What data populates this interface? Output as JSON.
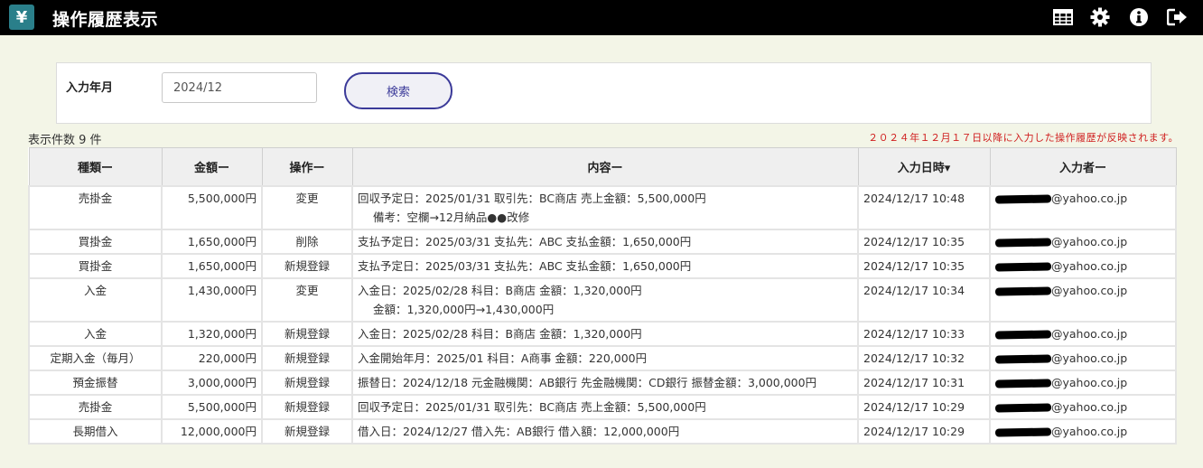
{
  "header": {
    "logo": "¥",
    "title": "操作履歴表示",
    "icons": [
      "table-icon",
      "gear-icon",
      "info-icon",
      "logout-icon"
    ]
  },
  "search": {
    "label": "入力年月",
    "value": "2024/12",
    "button": "検索"
  },
  "count_label": "表示件数 9 件",
  "notice": "２０２４年１２月１７日以降に入力した操作履歴が反映されます。",
  "table": {
    "headers": [
      "種類ー",
      "金額ー",
      "操作ー",
      "内容ー",
      "入力日時▾",
      "入力者ー"
    ],
    "rows": [
      {
        "type": "売掛金",
        "amount": "5,500,000円",
        "op": "変更",
        "content": "回収予定日：2025/01/31 取引先：BC商店 売上金額：5,500,000円",
        "content2": "備考：空欄→12月納品●●改修",
        "date": "2024/12/17 10:48",
        "user": "@yahoo.co.jp"
      },
      {
        "type": "買掛金",
        "amount": "1,650,000円",
        "op": "削除",
        "content": "支払予定日：2025/03/31 支払先：ABC 支払金額：1,650,000円",
        "content2": "",
        "date": "2024/12/17 10:35",
        "user": "@yahoo.co.jp"
      },
      {
        "type": "買掛金",
        "amount": "1,650,000円",
        "op": "新規登録",
        "content": "支払予定日：2025/03/31 支払先：ABC 支払金額：1,650,000円",
        "content2": "",
        "date": "2024/12/17 10:35",
        "user": "@yahoo.co.jp"
      },
      {
        "type": "入金",
        "amount": "1,430,000円",
        "op": "変更",
        "content": "入金日：2025/02/28 科目：B商店 金額：1,320,000円",
        "content2": "金額：1,320,000円→1,430,000円",
        "date": "2024/12/17 10:34",
        "user": "@yahoo.co.jp"
      },
      {
        "type": "入金",
        "amount": "1,320,000円",
        "op": "新規登録",
        "content": "入金日：2025/02/28 科目：B商店 金額：1,320,000円",
        "content2": "",
        "date": "2024/12/17 10:33",
        "user": "@yahoo.co.jp"
      },
      {
        "type": "定期入金（毎月）",
        "amount": "220,000円",
        "op": "新規登録",
        "content": "入金開始年月：2025/01 科目：A商事 金額：220,000円",
        "content2": "",
        "date": "2024/12/17 10:32",
        "user": "@yahoo.co.jp"
      },
      {
        "type": "預金振替",
        "amount": "3,000,000円",
        "op": "新規登録",
        "content": "振替日：2024/12/18 元金融機関：AB銀行 先金融機関：CD銀行 振替金額：3,000,000円",
        "content2": "",
        "date": "2024/12/17 10:31",
        "user": "@yahoo.co.jp"
      },
      {
        "type": "売掛金",
        "amount": "5,500,000円",
        "op": "新規登録",
        "content": "回収予定日：2025/01/31 取引先：BC商店 売上金額：5,500,000円",
        "content2": "",
        "date": "2024/12/17 10:29",
        "user": "@yahoo.co.jp"
      },
      {
        "type": "長期借入",
        "amount": "12,000,000円",
        "op": "新規登録",
        "content": "借入日：2024/12/27 借入先：AB銀行 借入額：12,000,000円",
        "content2": "",
        "date": "2024/12/17 10:29",
        "user": "@yahoo.co.jp"
      }
    ]
  }
}
